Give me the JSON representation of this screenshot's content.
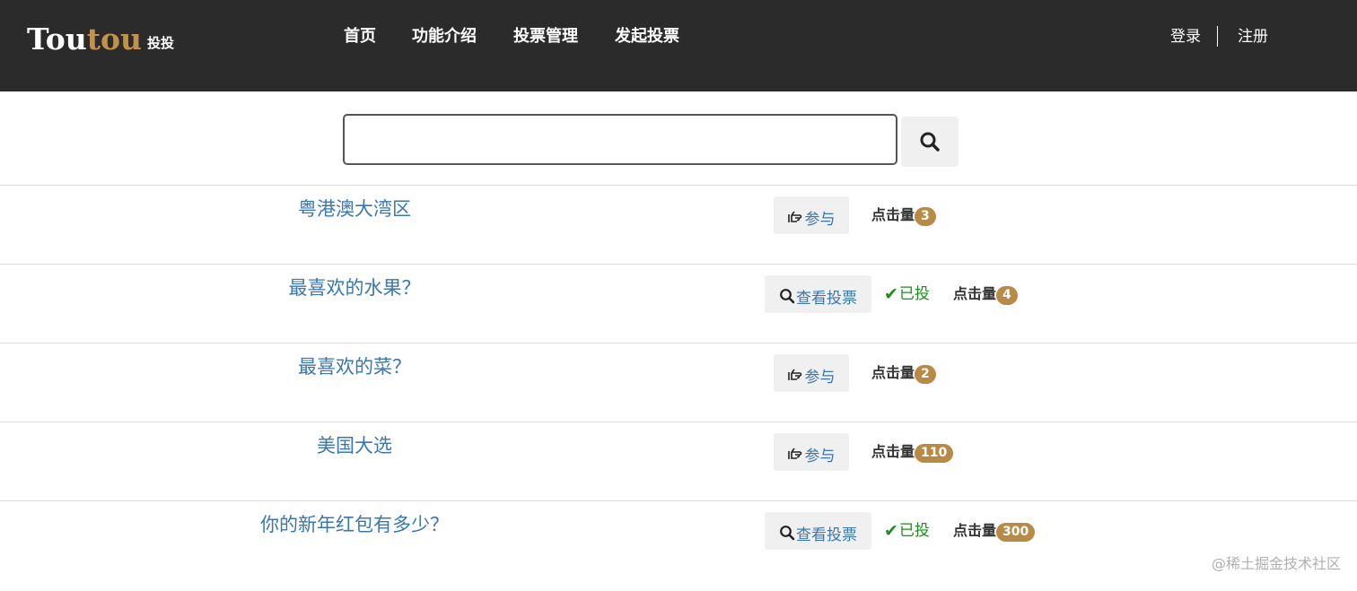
{
  "brand": {
    "part1": "Tou",
    "part2": "tou",
    "sub": "投投"
  },
  "nav": {
    "items": [
      "首页",
      "功能介绍",
      "投票管理",
      "发起投票"
    ]
  },
  "auth": {
    "login": "登录",
    "register": "注册"
  },
  "search": {
    "value": "",
    "placeholder": ""
  },
  "rows": [
    {
      "title": "粤港澳大湾区",
      "action": "参与",
      "action_icon": "hand-pointing-icon",
      "clicks_label": "点击量",
      "clicks": "3"
    },
    {
      "title": "最喜欢的水果？",
      "action": "查看投票",
      "action_icon": "search-icon",
      "voted": "已投",
      "clicks_label": "点击量",
      "clicks": "4"
    },
    {
      "title": "最喜欢的菜？",
      "action": "参与",
      "action_icon": "hand-pointing-icon",
      "clicks_label": "点击量",
      "clicks": "2"
    },
    {
      "title": "美国大选",
      "action": "参与",
      "action_icon": "hand-pointing-icon",
      "clicks_label": "点击量",
      "clicks": "110"
    },
    {
      "title": "你的新年红包有多少？",
      "action": "查看投票",
      "action_icon": "search-icon",
      "voted": "已投",
      "clicks_label": "点击量",
      "clicks": "300"
    }
  ],
  "watermark": "@稀土掘金技术社区",
  "colors": {
    "navbar": "#2b2b2b",
    "brand_accent": "#c2924a",
    "link": "#3a77b0",
    "voted": "#1e8c1e",
    "badge": "#b98a45"
  }
}
